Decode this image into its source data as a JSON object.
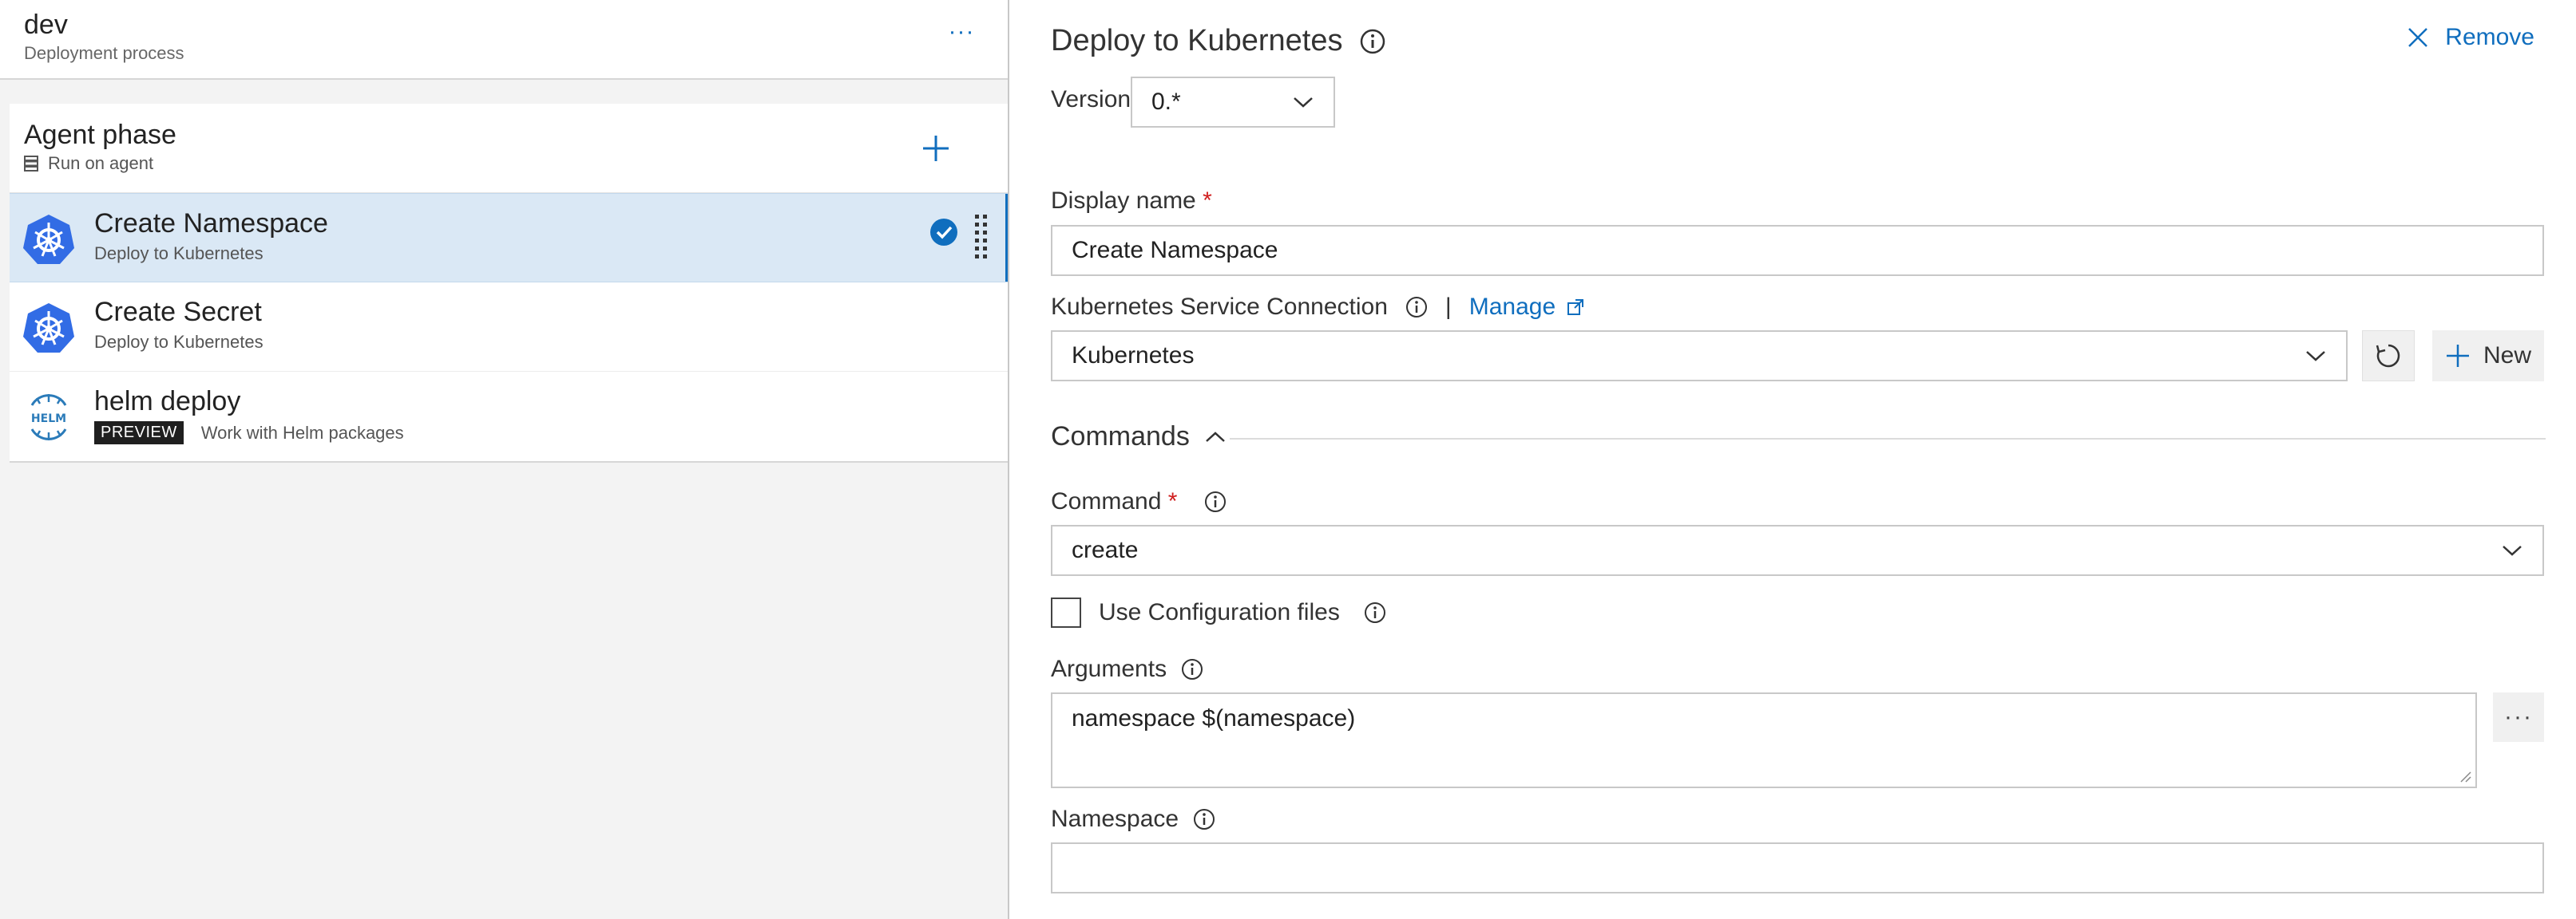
{
  "stage": {
    "name": "dev",
    "subtitle": "Deployment process",
    "more_label": "···"
  },
  "phase": {
    "title": "Agent phase",
    "subtitle": "Run on agent"
  },
  "tasks": [
    {
      "title": "Create Namespace",
      "subtitle": "Deploy to Kubernetes",
      "icon": "kubernetes-icon",
      "selected": true
    },
    {
      "title": "Create Secret",
      "subtitle": "Deploy to Kubernetes",
      "icon": "kubernetes-icon",
      "selected": false
    },
    {
      "title": "helm deploy",
      "subtitle": "Work with Helm packages",
      "badge": "PREVIEW",
      "icon": "helm-icon",
      "selected": false
    }
  ],
  "panel": {
    "title": "Deploy to Kubernetes",
    "remove_label": "Remove",
    "version_label": "Version",
    "version_value": "0.*",
    "display_name_label": "Display name",
    "required_mark": "*",
    "display_name_value": "Create Namespace",
    "connection_label": "Kubernetes Service Connection",
    "separator": "|",
    "manage_label": "Manage",
    "connection_value": "Kubernetes",
    "new_label": "New",
    "commands_section": "Commands",
    "command_label": "Command",
    "command_value": "create",
    "use_config_label": "Use Configuration files",
    "use_config_checked": false,
    "arguments_label": "Arguments",
    "arguments_value": "namespace $(namespace)",
    "arguments_more": "···",
    "namespace_label": "Namespace",
    "namespace_value": ""
  },
  "colors": {
    "accent": "#106ebe",
    "selected_row": "#dae8f5",
    "kubernetes_blue": "#326ce5",
    "required": "#d01e1e",
    "badge_bg": "#1f1f1f"
  }
}
